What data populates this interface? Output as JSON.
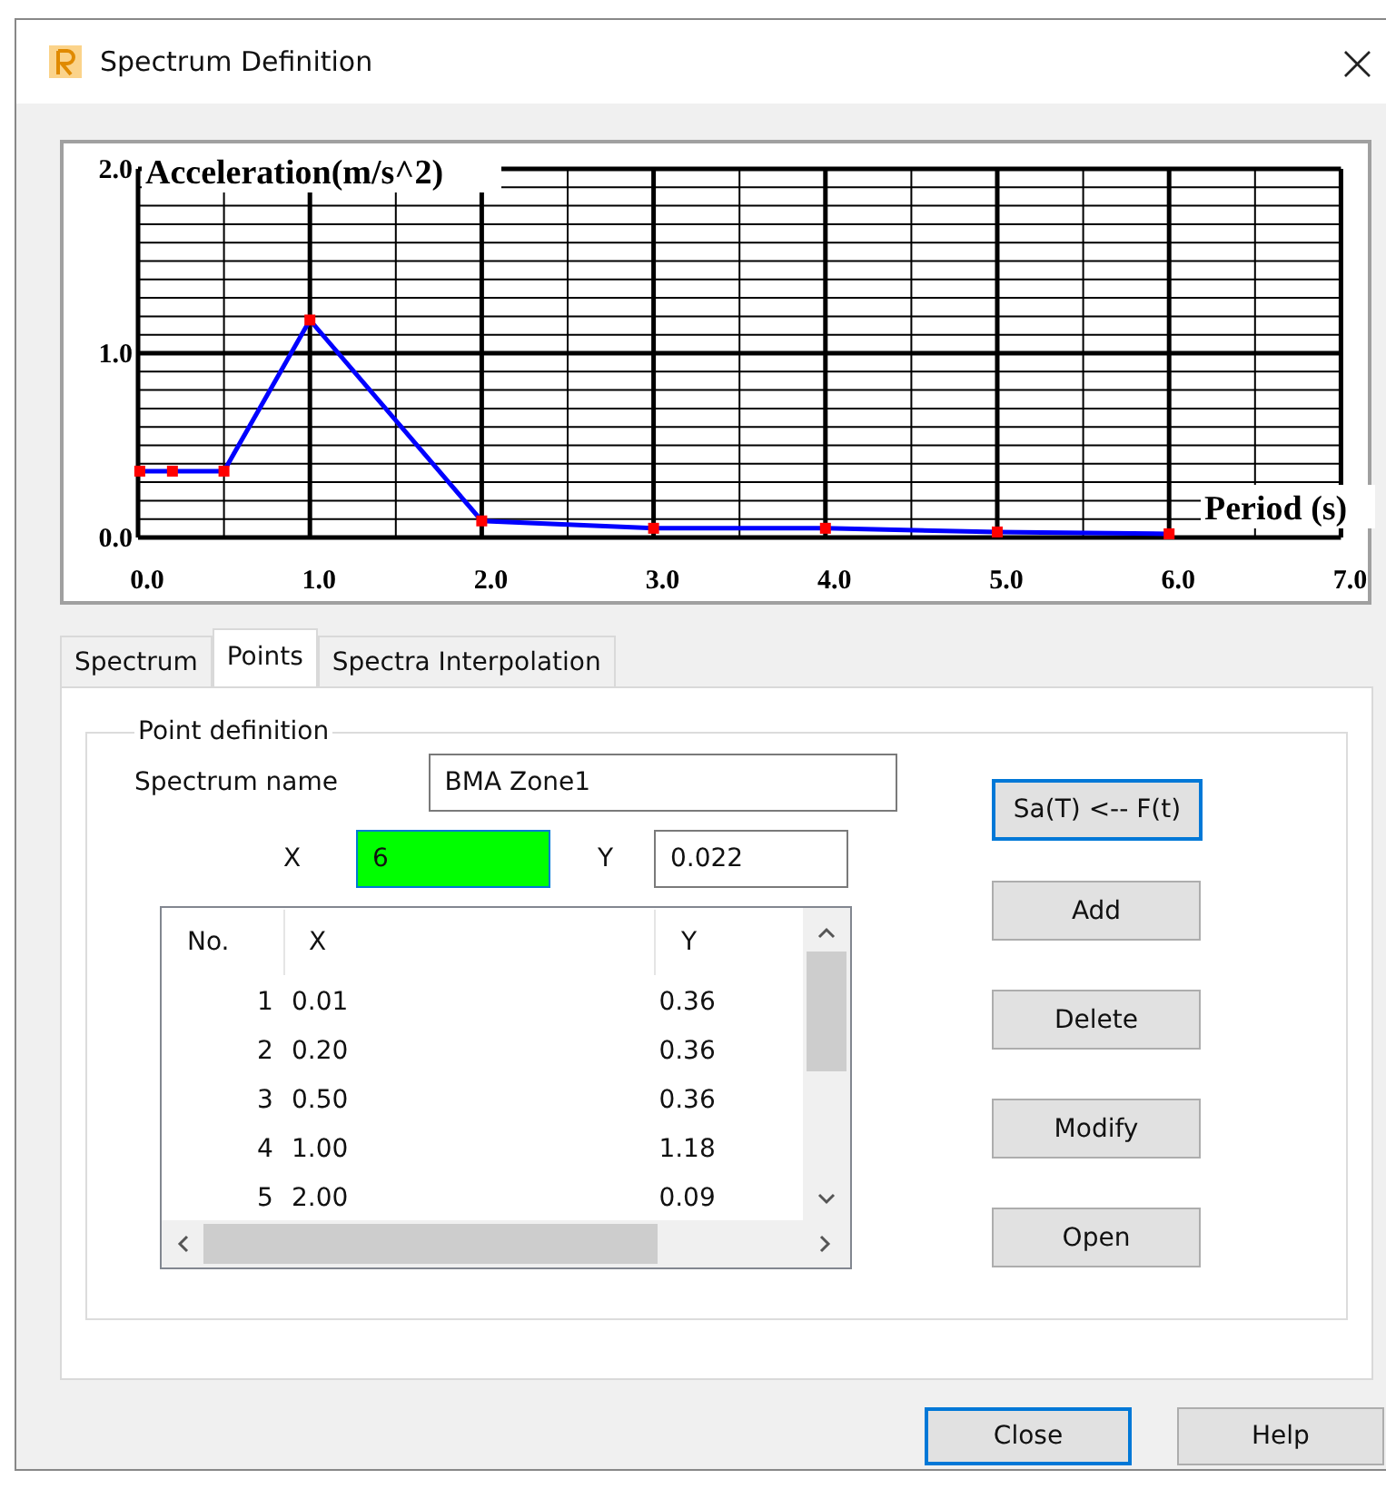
{
  "window": {
    "title": "Spectrum Definition",
    "close": "×"
  },
  "chart": {
    "chart_data": {
      "type": "line",
      "xlabel": "Period (s)",
      "ylabel": "Acceleration(m/s^2)",
      "x": [
        0.01,
        0.2,
        0.5,
        1.0,
        2.0,
        3.0,
        4.0,
        5.0,
        6.0
      ],
      "series": [
        {
          "color": "#0000ff",
          "marker": true,
          "values": [
            0.36,
            0.36,
            0.36,
            1.18,
            0.09,
            0.05,
            0.05,
            0.03,
            0.02
          ]
        }
      ],
      "grid": true,
      "xlim": [
        0,
        7
      ],
      "ylim": [
        0,
        2
      ],
      "xticks": [
        {
          "value": 0,
          "label": "0.0"
        },
        {
          "value": 1,
          "label": "1.0"
        },
        {
          "value": 2,
          "label": "2.0"
        },
        {
          "value": 3,
          "label": "3.0"
        },
        {
          "value": 4,
          "label": "4.0"
        },
        {
          "value": 5,
          "label": "5.0"
        },
        {
          "value": 6,
          "label": "6.0"
        },
        {
          "value": 7,
          "label": "7.0"
        }
      ],
      "yticks": [
        {
          "value": 0,
          "label": "0.0"
        },
        {
          "value": 1,
          "label": "1.0"
        },
        {
          "value": 2,
          "label": "2.0"
        }
      ]
    }
  },
  "tabs": [
    {
      "label": "Spectrum",
      "selected": false
    },
    {
      "label": "Points",
      "selected": true
    },
    {
      "label": "Spectra Interpolation",
      "selected": false
    }
  ],
  "group": {
    "title": "Point definition",
    "spectrum_name": {
      "label": "Spectrum name",
      "value": "BMA Zone1"
    },
    "x_field": {
      "label": "X",
      "value": "6",
      "focused": true
    },
    "y_field": {
      "label": "Y",
      "value": "0.022",
      "focused": false
    },
    "table": {
      "columns": [
        "No.",
        "X",
        "Y"
      ],
      "rows": [
        [
          "1",
          "0.01",
          "0.36"
        ],
        [
          "2",
          "0.20",
          "0.36"
        ],
        [
          "3",
          "0.50",
          "0.36"
        ],
        [
          "4",
          "1.00",
          "1.18"
        ],
        [
          "5",
          "2.00",
          "0.09"
        ]
      ]
    },
    "side_buttons": [
      {
        "label": "Sa(T) <-- F(t)",
        "default": true
      },
      {
        "label": "Add",
        "default": false
      },
      {
        "label": "Delete",
        "default": false
      },
      {
        "label": "Modify",
        "default": false
      },
      {
        "label": "Open",
        "default": false
      }
    ]
  },
  "buttons": [
    {
      "label": "Close",
      "default": true
    },
    {
      "label": "Help",
      "default": false
    }
  ]
}
